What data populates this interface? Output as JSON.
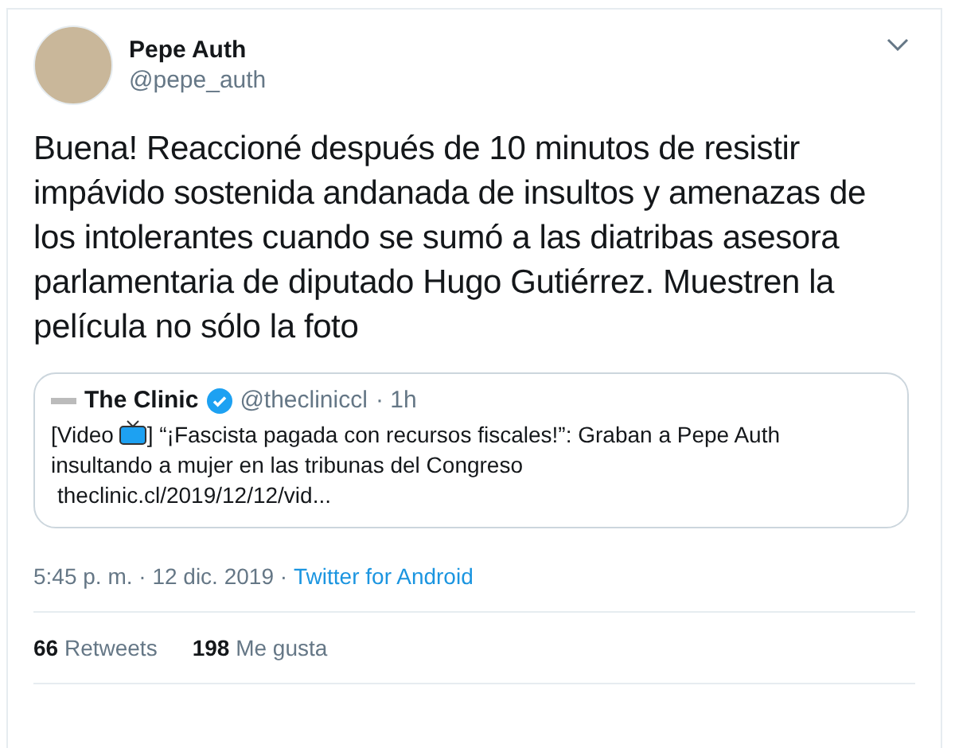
{
  "author": {
    "name": "Pepe Auth",
    "handle": "@pepe_auth"
  },
  "text": "Buena! Reaccioné después de 10 minutos de resistir impávido sostenida andanada de insultos y amenazas de los intolerantes cuando se sumó a las diatribas asesora parlamentaria de diputado Hugo Gutiérrez. Muestren la película no sólo la foto",
  "quote": {
    "name": "The Clinic",
    "verified": true,
    "handle": "@thecliniccl",
    "time": "· 1h",
    "text_before": "[Video",
    "text_after": "] “¡Fascista pagada con recursos fiscales!”: Graban a Pepe Auth",
    "text_line2": "insultando a mujer en las tribunas del Congreso",
    "link": "theclinic.cl/2019/12/12/vid..."
  },
  "meta": {
    "timestamp": "5:45 p. m. · 12 dic. 2019 ·",
    "source": "Twitter for Android"
  },
  "stats": [
    "**66** Retweets",
    "**198** Me gusta"
  ]
}
